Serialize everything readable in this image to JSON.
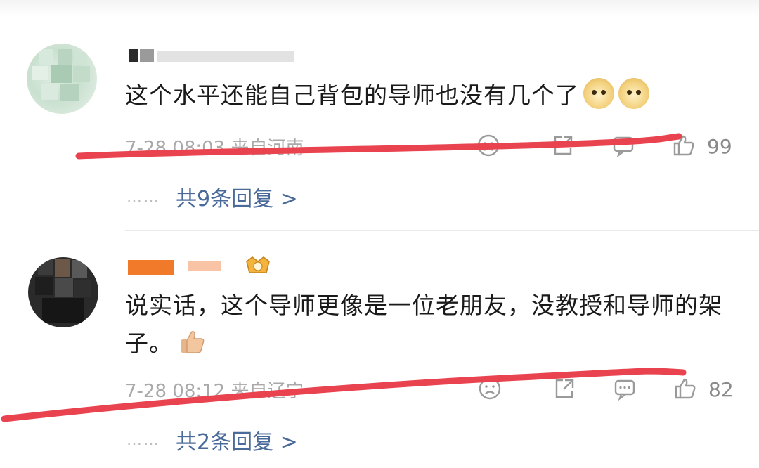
{
  "comments": [
    {
      "username": "",
      "text": "这个水平还能自己背包的导师也没有几个了",
      "emoji": [
        "doge-icon",
        "doge-icon"
      ],
      "meta": "7-28 08:03 来自河南",
      "likes": "99",
      "replies": "共9条回复 >"
    },
    {
      "username": "",
      "text": "说实话，这个导师更像是一位老朋友，没教授和导师的架子。",
      "emoji": [
        "thumbs-up-icon"
      ],
      "meta": "7-28 08:12 来自辽宁",
      "likes": "82",
      "replies": "共2条回复 >"
    }
  ],
  "reply_prefix": "……",
  "icons": [
    "dislike-face-icon",
    "share-icon",
    "comment-icon",
    "like-icon"
  ],
  "colors": {
    "reply_link": "#4a6a9a",
    "meta_text": "#a9a9a9",
    "annotation_stroke": "#e8434f"
  }
}
